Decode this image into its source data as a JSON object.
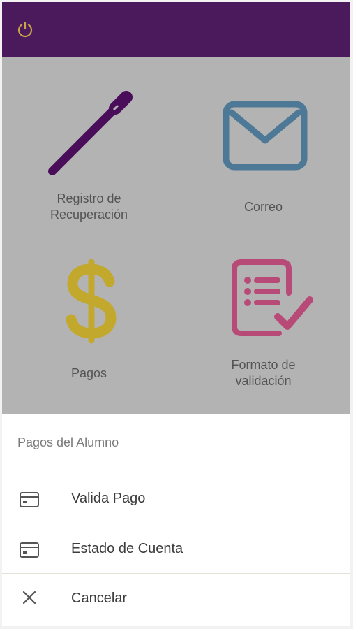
{
  "tiles": [
    {
      "label": "Registro de\nRecuperación",
      "icon": "pencil-icon",
      "color": "#4a0d5a"
    },
    {
      "label": "Correo",
      "icon": "envelope-icon",
      "color": "#4d7896"
    },
    {
      "label": "Pagos",
      "icon": "dollar-icon",
      "color": "#c2a92e"
    },
    {
      "label": "Formato de\nvalidación",
      "icon": "checklist-icon",
      "color": "#b84a78"
    }
  ],
  "toolbar": {
    "power_icon": "power-icon",
    "power_color": "#c9a24a",
    "background": "#4a1a5c"
  },
  "sheet": {
    "title": "Pagos del Alumno",
    "items": [
      {
        "label": "Valida Pago",
        "icon": "card-icon"
      },
      {
        "label": "Estado de Cuenta",
        "icon": "card-icon"
      },
      {
        "label": "Cancelar",
        "icon": "close-icon"
      }
    ]
  }
}
